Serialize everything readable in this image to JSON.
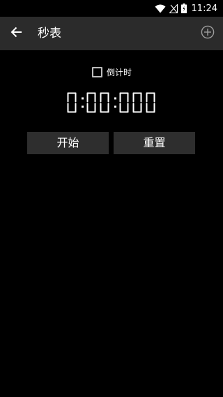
{
  "status_bar": {
    "time": "11:24",
    "icons": [
      "wifi-icon",
      "signal-icon",
      "battery-icon"
    ]
  },
  "app_bar": {
    "title": "秒表",
    "back_icon": "arrow-back-icon",
    "add_icon": "add-circle-icon"
  },
  "countdown": {
    "label": "倒计时",
    "checked": false
  },
  "stopwatch": {
    "display": "0:00:000"
  },
  "buttons": {
    "start_label": "开始",
    "reset_label": "重置"
  },
  "colors": {
    "background": "#000000",
    "app_bar": "#2b2b2b",
    "button": "#2e2e2e",
    "text": "#ffffff"
  }
}
